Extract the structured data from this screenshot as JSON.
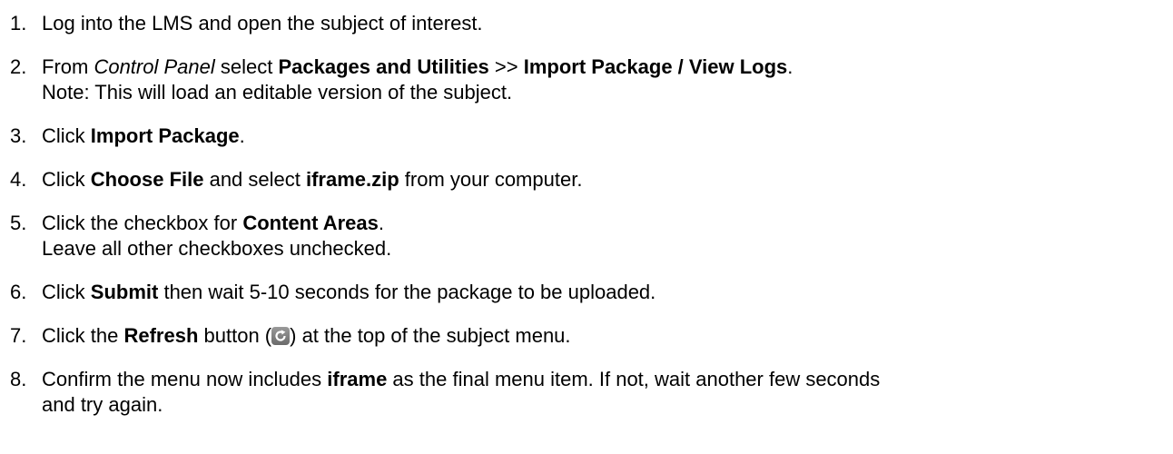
{
  "steps": [
    {
      "num": "1.",
      "parts": {
        "t1": "Log into the LMS and open the subject of interest."
      }
    },
    {
      "num": "2.",
      "parts": {
        "t1": "From ",
        "i1": "Control Panel",
        "t2": " select ",
        "b1": "Packages and Utilities",
        "t3": " >> ",
        "b2": "Import Package / View Logs",
        "t4": ".",
        "note": "Note: This will load an editable version of the subject."
      }
    },
    {
      "num": "3.",
      "parts": {
        "t1": "Click ",
        "b1": "Import Package",
        "t2": "."
      }
    },
    {
      "num": "4.",
      "parts": {
        "t1": "Click ",
        "b1": "Choose File",
        "t2": " and select ",
        "b2": "iframe.zip",
        "t3": " from your computer."
      }
    },
    {
      "num": "5.",
      "parts": {
        "t1": "Click the checkbox for ",
        "b1": "Content Areas",
        "t2": ".",
        "line2": "Leave all other checkboxes unchecked."
      }
    },
    {
      "num": "6.",
      "parts": {
        "t1": "Click ",
        "b1": "Submit",
        "t2": " then wait 5-10 seconds for the package to be uploaded."
      }
    },
    {
      "num": "7.",
      "parts": {
        "t1": "Click the ",
        "b1": "Refresh",
        "t2": " button (",
        "icon": "refresh-icon",
        "t3": ") at the top of the subject menu."
      }
    },
    {
      "num": "8.",
      "parts": {
        "t1": "Confirm the menu now includes ",
        "b1": "iframe",
        "t2": " as the final menu item. If not, wait another few seconds",
        "line2": "and try again."
      }
    }
  ]
}
